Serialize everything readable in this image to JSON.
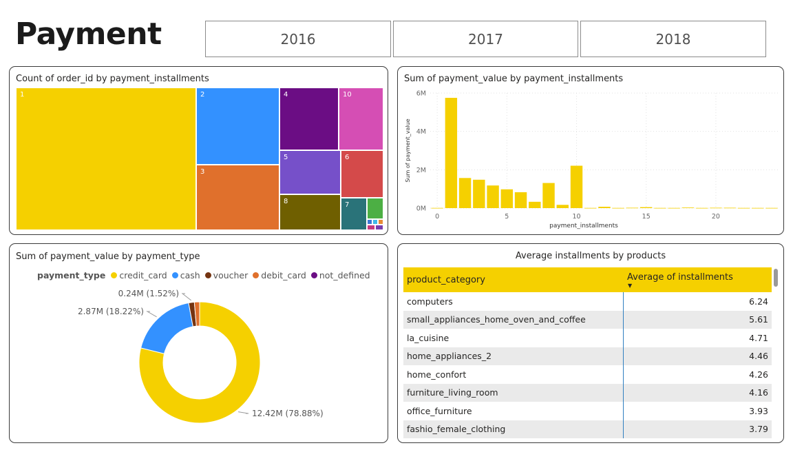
{
  "page": {
    "title": "Payment"
  },
  "slicer": {
    "years": [
      "2016",
      "2017",
      "2018"
    ]
  },
  "treemap": {
    "title": "Count of order_id by payment_installments",
    "cells": [
      {
        "label": "1",
        "color": "#F5D000"
      },
      {
        "label": "2",
        "color": "#3391FF"
      },
      {
        "label": "3",
        "color": "#E0702C"
      },
      {
        "label": "4",
        "color": "#6B0D84"
      },
      {
        "label": "10",
        "color": "#D54EB4"
      },
      {
        "label": "5",
        "color": "#7650C9"
      },
      {
        "label": "6",
        "color": "#D44A4A"
      },
      {
        "label": "8",
        "color": "#6F5F00"
      },
      {
        "label": "7",
        "color": "#2A7379"
      },
      {
        "label": "",
        "color": "#4CAF44"
      },
      {
        "label": "",
        "color": "#3B78D4"
      },
      {
        "label": "",
        "color": "#3FB9E9"
      },
      {
        "label": "",
        "color": "#E88A35"
      },
      {
        "label": "",
        "color": "#C63A7E"
      },
      {
        "label": "",
        "color": "#7A3DAE"
      }
    ]
  },
  "bar_chart": {
    "title": "Sum of payment_value by payment_installments",
    "ylabel": "Sum of payment_value",
    "xlabel": "payment_installments",
    "yticks": [
      "0M",
      "2M",
      "4M",
      "6M"
    ],
    "xticks": [
      "0",
      "5",
      "10",
      "15",
      "20"
    ],
    "color": "#F5D000"
  },
  "donut": {
    "title": "Sum of payment_value by payment_type",
    "legend_title": "payment_type",
    "slices": [
      {
        "name": "credit_card",
        "color": "#F5D000",
        "label": "12.42M (78.88%)"
      },
      {
        "name": "cash",
        "color": "#3391FF",
        "label": "2.87M (18.22%)"
      },
      {
        "name": "voucher",
        "color": "#743411",
        "label": "0.24M (1.52%)"
      },
      {
        "name": "debit_card",
        "color": "#E0702C",
        "label": ""
      },
      {
        "name": "not_defined",
        "color": "#6B0D84",
        "label": ""
      }
    ]
  },
  "table": {
    "title": "Average installments by products",
    "col1": "product_category",
    "col2": "Average of installments",
    "rows": [
      {
        "category": "computers",
        "value": "6.24"
      },
      {
        "category": "small_appliances_home_oven_and_coffee",
        "value": "5.61"
      },
      {
        "category": "la_cuisine",
        "value": "4.71"
      },
      {
        "category": "home_appliances_2",
        "value": "4.46"
      },
      {
        "category": "home_confort",
        "value": "4.26"
      },
      {
        "category": "furniture_living_room",
        "value": "4.16"
      },
      {
        "category": "office_furniture",
        "value": "3.93"
      },
      {
        "category": "fashio_female_clothing",
        "value": "3.79"
      }
    ]
  },
  "chart_data": [
    {
      "type": "bar",
      "title": "Sum of payment_value by payment_installments",
      "xlabel": "payment_installments",
      "ylabel": "Sum of payment_value",
      "ylim": [
        0,
        6
      ],
      "y_unit": "M",
      "x": [
        0,
        1,
        2,
        3,
        4,
        5,
        6,
        7,
        8,
        9,
        10,
        11,
        12,
        13,
        14,
        15,
        16,
        17,
        18,
        19,
        20,
        21,
        22,
        23,
        24
      ],
      "values": [
        0.01,
        5.75,
        1.57,
        1.48,
        1.18,
        0.98,
        0.83,
        0.33,
        1.31,
        0.17,
        2.21,
        0.01,
        0.07,
        0.01,
        0.02,
        0.05,
        0.01,
        0.01,
        0.03,
        0.01,
        0.02,
        0.02,
        0.01,
        0.01,
        0.01
      ]
    },
    {
      "type": "pie",
      "title": "Sum of payment_value by payment_type",
      "categories": [
        "credit_card",
        "cash",
        "voucher",
        "debit_card",
        "not_defined"
      ],
      "values": [
        12.42,
        2.87,
        0.24,
        0.22,
        0.0
      ],
      "percent": [
        78.88,
        18.22,
        1.52,
        1.38,
        0.0
      ],
      "unit": "M"
    }
  ]
}
